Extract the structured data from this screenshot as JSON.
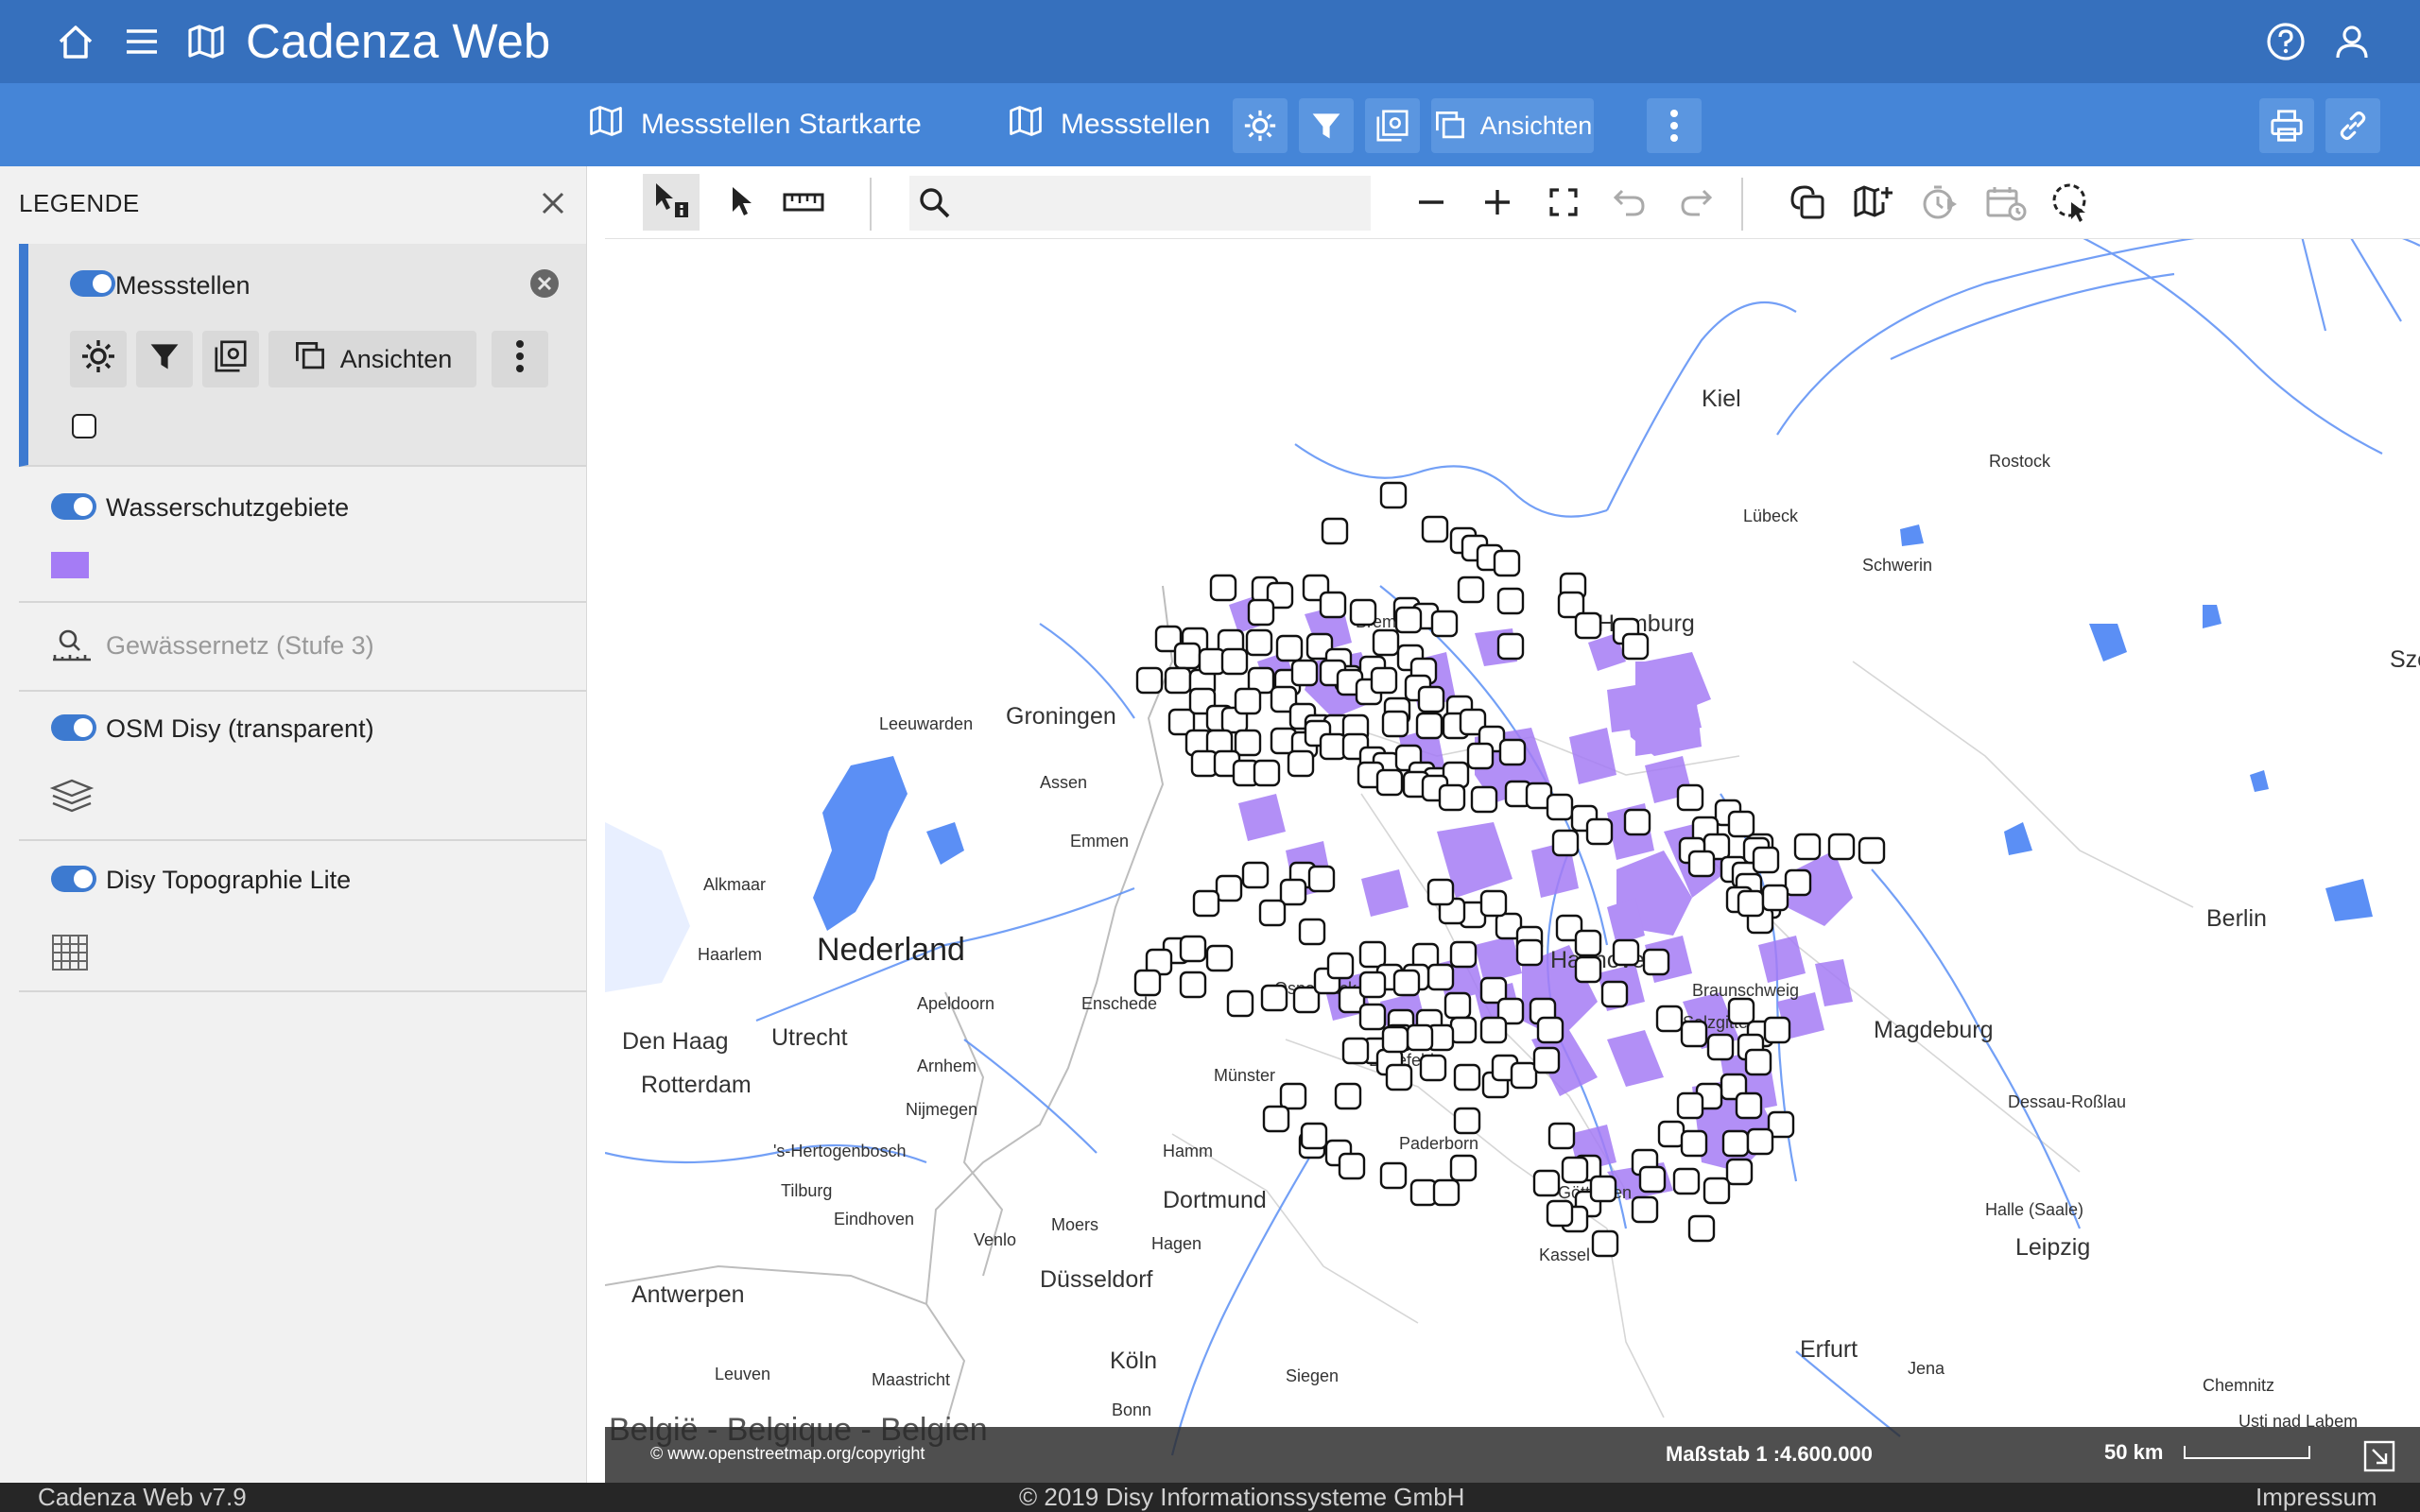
{
  "header": {
    "title": "Cadenza Web"
  },
  "toolbar": {
    "map_start_label": "Messstellen Startkarte",
    "layer_label": "Messstellen",
    "views_label": "Ansichten"
  },
  "legend": {
    "title": "LEGENDE",
    "layers": [
      {
        "name": "Messstellen",
        "views_label": "Ansichten"
      },
      {
        "name": "Wasserschutzgebiete"
      },
      {
        "name": "Gewässernetz (Stufe 3)"
      },
      {
        "name": "OSM Disy (transparent)"
      },
      {
        "name": "Disy Topographie Lite"
      }
    ]
  },
  "map": {
    "search_placeholder": "",
    "copyright": "© www.openstreetmap.org/copyright",
    "scale_label": "Maßstab 1 :4.600.000",
    "scalebar_label": "50 km",
    "cities": [
      "Kiel",
      "Rostock",
      "Lübeck",
      "Schwerin",
      "Hamburg",
      "Bremen",
      "Groningen",
      "Leeuwarden",
      "Assen",
      "Emmen",
      "Alkmaar",
      "Nederland",
      "Haarlem",
      "Den Haag",
      "Utrecht",
      "Rotterdam",
      "Apeldoorn",
      "Enschede",
      "Arnhem",
      "Nijmegen",
      "'s-Hertogenbosch",
      "Tilburg",
      "Eindhoven",
      "Venlo",
      "Antwerpen",
      "Leuven",
      "Maastricht",
      "België - Belgique - Belgien",
      "Münster",
      "Bielefeld",
      "Osnabrück",
      "Hannover",
      "Braunschweig",
      "Salzgitter",
      "Magdeburg",
      "Berlin",
      "Dessau-Roßlau",
      "Halle (Saale)",
      "Leipzig",
      "Hamm",
      "Paderborn",
      "Dortmund",
      "Moers",
      "Hagen",
      "Düsseldorf",
      "Göttingen",
      "Kassel",
      "Köln",
      "Siegen",
      "Bonn",
      "Erfurt",
      "Jena",
      "Chemnitz",
      "Usti nad Labem",
      "Sze"
    ]
  },
  "status": {
    "version": "Cadenza Web v7.9",
    "copyright": "© 2019 Disy Informationssysteme GmbH",
    "impressum": "Impressum"
  },
  "colors": {
    "header": "#3670bd",
    "subheader": "#4585d7",
    "accent": "#3d7ad0",
    "protection_area": "#a57cf5",
    "water": "#5b8ff5"
  },
  "icons": [
    "home-icon",
    "menu-icon",
    "map-icon",
    "help-icon",
    "user-icon",
    "gear-icon",
    "filter-icon",
    "layer-settings-icon",
    "views-icon",
    "more-icon",
    "print-icon",
    "link-icon",
    "close-icon",
    "remove-icon",
    "info-cursor-icon",
    "pointer-icon",
    "ruler-icon",
    "search-icon",
    "zoom-out-icon",
    "zoom-in-icon",
    "fullscreen-icon",
    "undo-icon",
    "redo-icon",
    "overlay-icon",
    "add-map-icon",
    "timer-icon",
    "calendar-icon",
    "select-area-icon"
  ]
}
